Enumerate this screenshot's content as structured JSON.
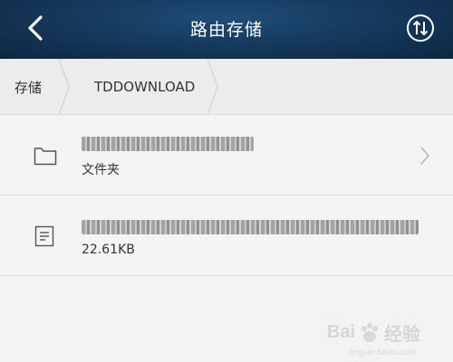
{
  "header": {
    "title": "路由存储",
    "back_icon": "chevron-left-icon",
    "sort_icon": "sort-arrows-icon"
  },
  "breadcrumb": {
    "items": [
      {
        "label": "存储"
      },
      {
        "label": "TDDOWNLOAD"
      }
    ]
  },
  "files": [
    {
      "type_icon": "folder-icon",
      "name": "",
      "subtitle": "文件夹",
      "has_chevron": true
    },
    {
      "type_icon": "document-icon",
      "name": "",
      "subtitle": "22.61KB",
      "has_chevron": false
    }
  ],
  "watermark": {
    "text_left": "Bai",
    "text_right": "经验",
    "sub": "jingyan.baidu.com"
  },
  "colors": {
    "header_bg": "#163a5e",
    "page_bg": "#f3f3f3",
    "breadcrumb_bg": "#ececec"
  }
}
